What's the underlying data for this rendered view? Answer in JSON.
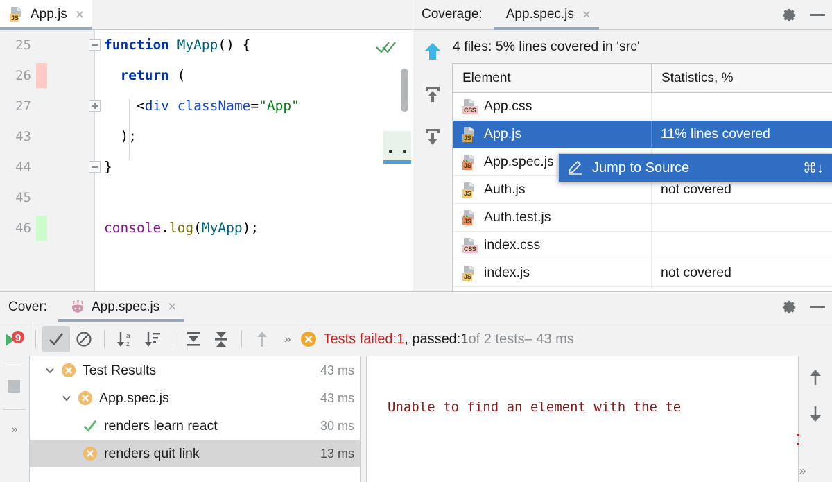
{
  "editor": {
    "tab": {
      "label": "App.js",
      "icon": "js-file-icon",
      "close": "×"
    },
    "inspection_icon": "double-check-ok-icon",
    "lines": [
      {
        "num": "25",
        "coverage": "none",
        "fold": "minus",
        "code": "function MyApp() {"
      },
      {
        "num": "26",
        "coverage": "uncovered",
        "fold": "none",
        "code": "  return ("
      },
      {
        "num": "27",
        "coverage": "none",
        "fold": "plus",
        "code": "    <div className=\"App\""
      },
      {
        "num": "43",
        "coverage": "none",
        "fold": "none",
        "code": "  );"
      },
      {
        "num": "44",
        "coverage": "none",
        "fold": "minus",
        "code": "}"
      },
      {
        "num": "45",
        "coverage": "none",
        "fold": "none",
        "code": ""
      },
      {
        "num": "46",
        "coverage": "covered",
        "fold": "none",
        "code": "console.log(MyApp);"
      }
    ]
  },
  "coverage": {
    "title": "Coverage:",
    "tab": {
      "label": "App.spec.js",
      "close": "×"
    },
    "gear_icon": "gear-icon",
    "minimize_icon": "minimize-icon",
    "summary": "4 files: 5% lines covered in 'src'",
    "toolbar": [
      "go-up-icon",
      "collapse-all-icon",
      "expand-all-icon"
    ],
    "columns": [
      "Element",
      "Statistics, %"
    ],
    "rows": [
      {
        "name": "App.css",
        "icon": "css-file-icon",
        "stat": "",
        "selected": false
      },
      {
        "name": "App.js",
        "icon": "js-file-icon",
        "stat": "11% lines covered",
        "selected": true
      },
      {
        "name": "App.spec.js",
        "icon": "js-test-file-icon",
        "stat": "",
        "selected": false
      },
      {
        "name": "Auth.js",
        "icon": "js-file-icon",
        "stat": "not covered",
        "selected": false
      },
      {
        "name": "Auth.test.js",
        "icon": "js-test-file-icon",
        "stat": "",
        "selected": false
      },
      {
        "name": "index.css",
        "icon": "css-file-icon",
        "stat": "",
        "selected": false
      },
      {
        "name": "index.js",
        "icon": "js-file-icon",
        "stat": "not covered",
        "selected": false
      }
    ],
    "context_menu": {
      "icon": "pencil-edit-icon",
      "label": "Jump to Source",
      "shortcut": "⌘↓"
    }
  },
  "runner": {
    "title": "Cover:",
    "tab": {
      "label": "App.spec.js",
      "icon": "jest-icon",
      "close": "×"
    },
    "gear_icon": "gear-icon",
    "minimize_icon": "minimize-icon",
    "toolbar": [
      {
        "name": "show-passed-toggle",
        "icon": "check-icon",
        "pressed": true
      },
      {
        "name": "show-ignored-toggle",
        "icon": "no-entry-icon",
        "pressed": false
      },
      {
        "name": "sort-alphabetically",
        "icon": "sort-az-icon",
        "pressed": false
      },
      {
        "name": "sort-by-duration",
        "icon": "sort-duration-icon",
        "pressed": false
      },
      {
        "name": "expand-all",
        "icon": "expand-all-icon",
        "pressed": false
      },
      {
        "name": "collapse-all",
        "icon": "collapse-all-icon",
        "pressed": false
      },
      {
        "name": "previous-failed-test",
        "icon": "arrow-up-icon",
        "pressed": false
      },
      {
        "name": "more-options",
        "icon": "chevron-double-right",
        "pressed": false
      }
    ],
    "status": {
      "icon": "failed-icon",
      "failed_label": "Tests failed: ",
      "failed_count": "1",
      "passed_label": ", passed: ",
      "passed_count": "1",
      "of_label": " of 2 tests ",
      "duration": "– 43 ms"
    },
    "rail": [
      {
        "name": "rerun-coverage-button",
        "icon": "rerun-with-coverage-icon"
      },
      {
        "name": "rerun-failed-button",
        "icon": "rerun-failed-tests-icon"
      },
      {
        "name": "stop-button",
        "icon": "stop-icon"
      },
      {
        "name": "more-button",
        "icon": "chevron-double-right"
      }
    ],
    "tree": [
      {
        "label": "Test Results",
        "time": "43 ms",
        "status": "failed",
        "depth": 0,
        "expanded": true,
        "selected": false
      },
      {
        "label": "App.spec.js",
        "time": "43 ms",
        "status": "failed",
        "depth": 1,
        "expanded": true,
        "selected": false
      },
      {
        "label": "renders learn react",
        "time": "30 ms",
        "status": "passed",
        "depth": 2,
        "expanded": null,
        "selected": false
      },
      {
        "label": "renders quit link",
        "time": "13 ms",
        "status": "failed",
        "depth": 2,
        "expanded": null,
        "selected": true
      }
    ],
    "detail_message": "Unable to find an element with the te",
    "detail_scroll": [
      "arrow-up-icon",
      "arrow-down-icon",
      "chevron-double-right"
    ]
  },
  "colors": {
    "selection_blue": "#2f6ec2",
    "fail_red": "#cf2020",
    "pass_green": "#59a869",
    "warn_orange": "#f0a732",
    "covered_green": "#ccfbcc",
    "uncovered_red": "#ffc9c6",
    "tab_underline": "#9aa7b7"
  }
}
